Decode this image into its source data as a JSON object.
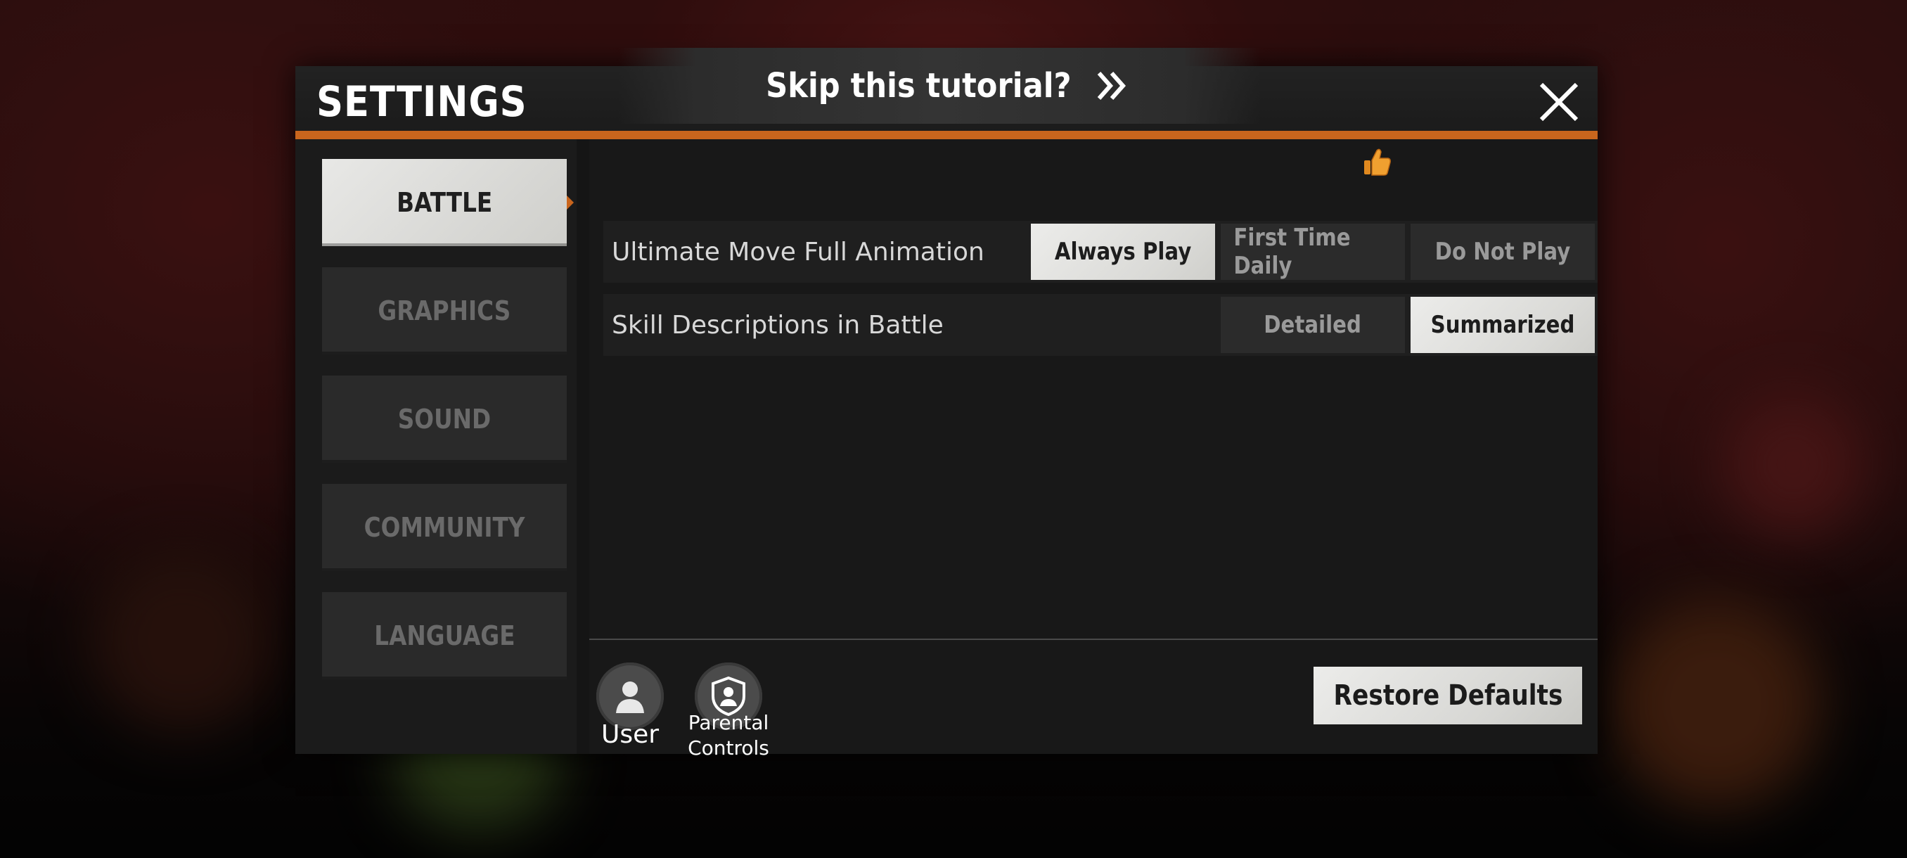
{
  "header": {
    "title": "SETTINGS",
    "skip_banner": "Skip this tutorial?"
  },
  "sidebar": {
    "tabs": [
      {
        "label": "BATTLE",
        "active": true
      },
      {
        "label": "GRAPHICS",
        "active": false
      },
      {
        "label": "SOUND",
        "active": false
      },
      {
        "label": "COMMUNITY",
        "active": false
      },
      {
        "label": "LANGUAGE",
        "active": false
      }
    ]
  },
  "settings": [
    {
      "label": "Ultimate Move Full Animation",
      "options": [
        "Always Play",
        "First Time Daily",
        "Do Not Play"
      ],
      "selected": "Always Play"
    },
    {
      "label": "Skill Descriptions in Battle",
      "options": [
        "Detailed",
        "Summarized"
      ],
      "selected": "Summarized"
    }
  ],
  "footer": {
    "user_label": "User",
    "parental_label_line1": "Parental",
    "parental_label_line2": "Controls",
    "restore_label": "Restore Defaults"
  },
  "colors": {
    "accent": "#c9651d",
    "panel": "#151515",
    "selected_option": "#e6e6e3"
  },
  "icons": [
    "close-icon",
    "double-chevron-right-icon",
    "thumbs-up-icon",
    "user-icon",
    "parental-shield-icon"
  ]
}
